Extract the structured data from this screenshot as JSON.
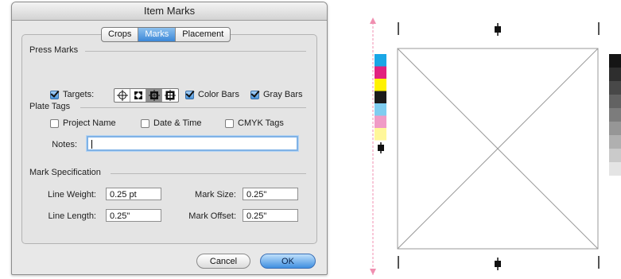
{
  "dialog": {
    "title": "Item Marks",
    "tabs": [
      "Crops",
      "Marks",
      "Placement"
    ],
    "active_tab": "Marks"
  },
  "press_marks": {
    "title": "Press Marks",
    "targets_label": "Targets:",
    "targets_checked": true,
    "target_styles": [
      "crosshair-target",
      "square-target-a",
      "square-target-selected",
      "square-target-b"
    ],
    "color_bars_label": "Color Bars",
    "color_bars_checked": true,
    "gray_bars_label": "Gray Bars",
    "gray_bars_checked": true
  },
  "plate_tags": {
    "title": "Plate Tags",
    "project_name_label": "Project Name",
    "project_name_checked": false,
    "date_time_label": "Date & Time",
    "date_time_checked": false,
    "cmyk_tags_label": "CMYK Tags",
    "cmyk_tags_checked": false,
    "notes_label": "Notes:",
    "notes_value": ""
  },
  "mark_spec": {
    "title": "Mark Specification",
    "line_weight_label": "Line Weight:",
    "line_weight_value": "0.25 pt",
    "mark_size_label": "Mark Size:",
    "mark_size_value": "0.25\"",
    "line_length_label": "Line Length:",
    "line_length_value": "0.25\"",
    "mark_offset_label": "Mark Offset:",
    "mark_offset_value": "0.25\""
  },
  "buttons": {
    "cancel": "Cancel",
    "ok": "OK"
  },
  "preview": {
    "color_bar_colors": [
      "#1aa7e6",
      "#e2217f",
      "#fff200",
      "#1b1b1b",
      "#7fcdf0",
      "#f09bc6",
      "#fff79a"
    ],
    "gray_bar_colors": [
      "#151515",
      "#2e2e2e",
      "#484848",
      "#626262",
      "#7c7c7c",
      "#969696",
      "#b0b0b0",
      "#cacaca",
      "#e4e4e4"
    ],
    "bleed_line_color": "#f08fb0"
  }
}
